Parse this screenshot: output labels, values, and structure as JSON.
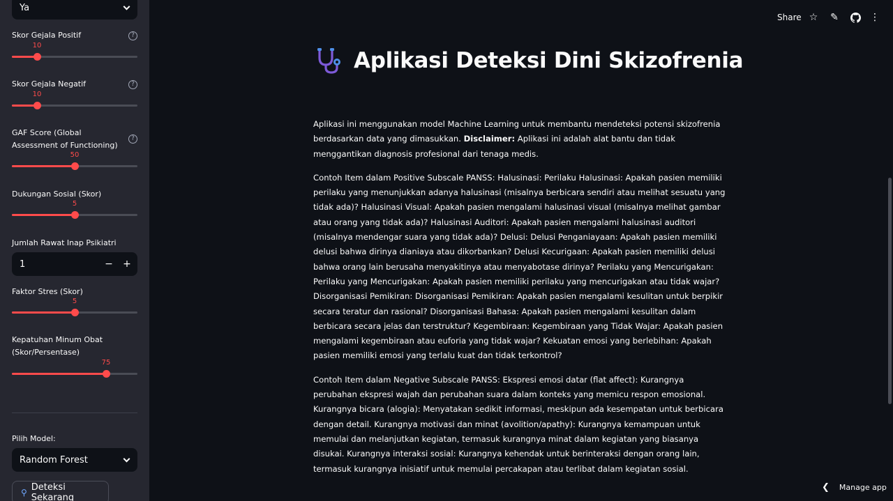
{
  "sidebar": {
    "top_select_value": "Ya",
    "sliders": [
      {
        "label": "Skor Gejala Positif",
        "value": "10",
        "fraction": 0.2,
        "help": true
      },
      {
        "label": "Skor Gejala Negatif",
        "value": "10",
        "fraction": 0.2,
        "help": true
      },
      {
        "label": "GAF Score (Global Assessment of Functioning)",
        "value": "50",
        "fraction": 0.5,
        "help": true
      },
      {
        "label": "Dukungan Sosial (Skor)",
        "value": "5",
        "fraction": 0.5,
        "help": false
      },
      {
        "label": "Faktor Stres (Skor)",
        "value": "5",
        "fraction": 0.5,
        "help": false
      },
      {
        "label": "Kepatuhan Minum Obat (Skor/Persentase)",
        "value": "75",
        "fraction": 0.75,
        "help": false
      }
    ],
    "number_input": {
      "label": "Jumlah Rawat Inap Psikiatri",
      "value": "1",
      "minus": "−",
      "plus": "+"
    },
    "model": {
      "label": "Pilih Model:",
      "value": "Random Forest"
    },
    "detect_button": "Deteksi Sekarang",
    "help_glyph": "?"
  },
  "header": {
    "share": "Share",
    "icons": [
      "star-icon",
      "pencil-icon",
      "github-icon",
      "more-icon"
    ]
  },
  "main": {
    "title": "Aplikasi Deteksi Dini Skizofrenia",
    "intro_pre": "Aplikasi ini menggunakan model Machine Learning untuk membantu mendeteksi potensi skizofrenia berdasarkan data yang dimasukkan. ",
    "intro_bold": "Disclaimer:",
    "intro_post": " Aplikasi ini adalah alat bantu dan tidak menggantikan diagnosis profesional dari tenaga medis.",
    "positive": "Contoh Item dalam Positive Subscale PANSS: Halusinasi: Perilaku Halusinasi: Apakah pasien memiliki perilaku yang menunjukkan adanya halusinasi (misalnya berbicara sendiri atau melihat sesuatu yang tidak ada)? Halusinasi Visual: Apakah pasien mengalami halusinasi visual (misalnya melihat gambar atau orang yang tidak ada)? Halusinasi Auditori: Apakah pasien mengalami halusinasi auditori (misalnya mendengar suara yang tidak ada)? Delusi: Delusi Penganiayaan: Apakah pasien memiliki delusi bahwa dirinya dianiaya atau dikorbankan? Delusi Kecurigaan: Apakah pasien memiliki delusi bahwa orang lain berusaha menyakitinya atau menyabotase dirinya? Perilaku yang Mencurigakan: Perilaku yang Mencurigakan: Apakah pasien memiliki perilaku yang mencurigakan atau tidak wajar? Disorganisasi Pemikiran: Disorganisasi Pemikiran: Apakah pasien mengalami kesulitan untuk berpikir secara teratur dan rasional? Disorganisasi Bahasa: Apakah pasien mengalami kesulitan dalam berbicara secara jelas dan terstruktur? Kegembiraan: Kegembiraan yang Tidak Wajar: Apakah pasien mengalami kegembiraan atau euforia yang tidak wajar? Kekuatan emosi yang berlebihan: Apakah pasien memiliki emosi yang terlalu kuat dan tidak terkontrol?",
    "negative": "Contoh Item dalam Negative Subscale PANSS: Ekspresi emosi datar (flat affect): Kurangnya perubahan ekspresi wajah dan perubahan suara dalam konteks yang memicu respon emosional. Kurangnya bicara (alogia): Menyatakan sedikit informasi, meskipun ada kesempatan untuk berbicara dengan detail. Kurangnya motivasi dan minat (avolition/apathy): Kurangnya kemampuan untuk memulai dan melanjutkan kegiatan, termasuk kurangnya minat dalam kegiatan yang biasanya disukai. Kurangnya interaksi sosial: Kurangnya kehendak untuk berinteraksi dengan orang lain, termasuk kurangnya inisiatif untuk memulai percakapan atau terlibat dalam kegiatan sosial."
  },
  "footer": {
    "manage_app": "Manage app"
  },
  "colors": {
    "accent": "#ff4b4b",
    "sidebar_bg": "#262730",
    "main_bg": "#0e1117"
  }
}
